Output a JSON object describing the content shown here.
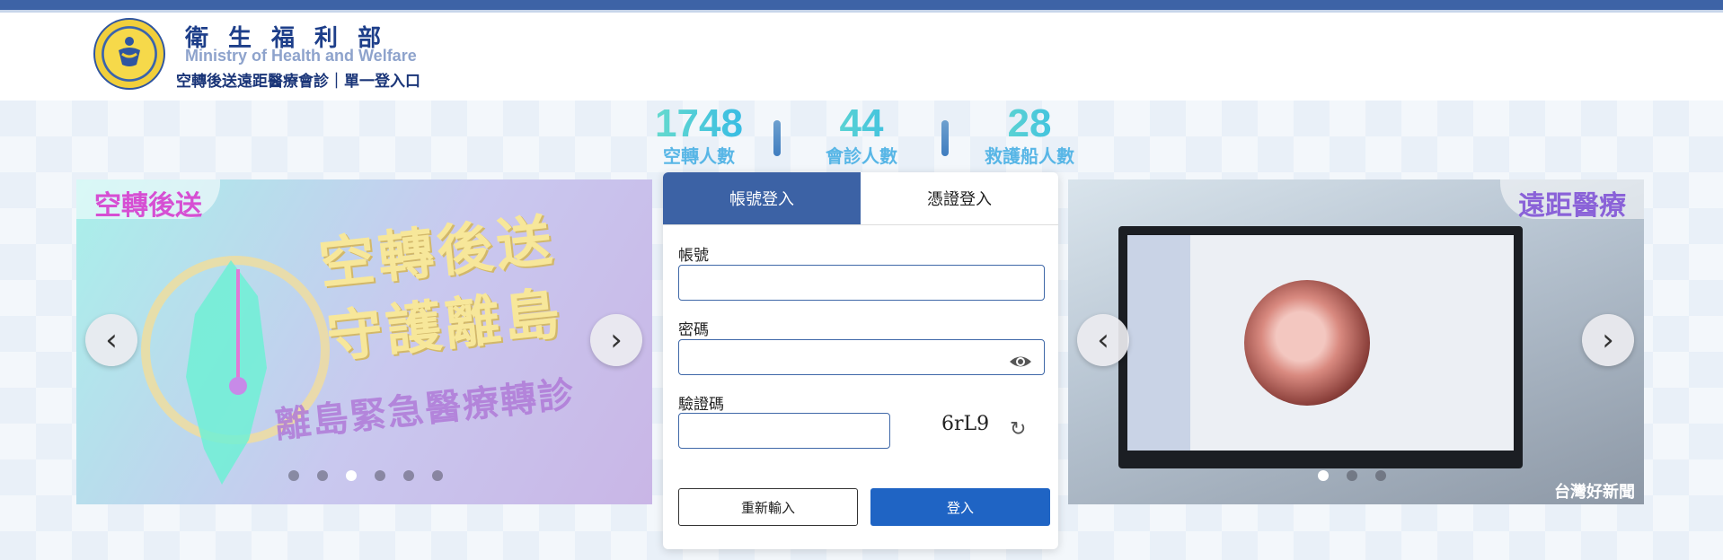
{
  "header": {
    "org_name_zh": "衛生福利部",
    "org_name_en": "Ministry of Health and Welfare",
    "subtitle": "空轉後送遠距醫療會診｜單一登入口"
  },
  "stats": [
    {
      "value": "1748",
      "label": "空轉人數"
    },
    {
      "value": "44",
      "label": "會診人數"
    },
    {
      "value": "28",
      "label": "救護船人數"
    }
  ],
  "left_carousel": {
    "tab_label": "空轉後送",
    "poster_title_line1": "空轉後送",
    "poster_title_line2": "守護離島",
    "poster_subtitle": "離島緊急醫療轉診",
    "slide_count": 6,
    "active_index": 2
  },
  "right_carousel": {
    "tab_label": "遠距醫療",
    "credit": "台灣好新聞",
    "slide_count": 3,
    "active_index": 0
  },
  "login": {
    "tabs": [
      "帳號登入",
      "憑證登入"
    ],
    "active_tab": 0,
    "account_label": "帳號",
    "account_value": "",
    "password_label": "密碼",
    "password_value": "",
    "captcha_label": "驗證碼",
    "captcha_value": "",
    "captcha_text": "6rL9",
    "reset_label": "重新輸入",
    "submit_label": "登入"
  },
  "colors": {
    "brand_blue": "#3c62a5",
    "login_button": "#1f64c4",
    "stat_gradient_start": "#6fe0c9",
    "stat_gradient_end": "#2fb6e8"
  },
  "icons": [
    "ministry-logo",
    "chevron-left-icon",
    "chevron-right-icon",
    "eye-icon",
    "refresh-icon"
  ]
}
